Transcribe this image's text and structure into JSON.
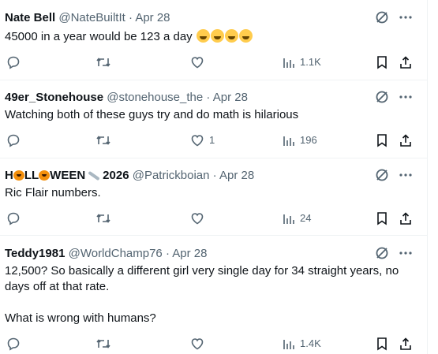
{
  "tweets": [
    {
      "name": "Nate Bell",
      "handle": "@NateBuiltIt",
      "dot": "·",
      "date": "Apr 28",
      "text": "45000 in a year would be 123 a day",
      "emoji": "rolling-on-floor-laughing-emoji x4",
      "reply_count": "",
      "retweet_count": "",
      "like_count": "",
      "views": "1.1K"
    },
    {
      "name": "49er_Stonehouse",
      "handle": "@stonehouse_the",
      "dot": "·",
      "date": "Apr 28",
      "text": "Watching both of these guys try and do math is hilarious",
      "reply_count": "",
      "retweet_count": "",
      "like_count": "1",
      "views": "196"
    },
    {
      "name_parts": [
        "H",
        "LL",
        "WEEN",
        "2026"
      ],
      "handle": "@Patrickboian",
      "dot": "·",
      "date": "Apr 28",
      "text": "Ric Flair numbers.",
      "reply_count": "",
      "retweet_count": "",
      "like_count": "",
      "views": "24"
    },
    {
      "name": "Teddy1981",
      "handle": "@WorldChamp76",
      "dot": "·",
      "date": "Apr 28",
      "text_line1": "12,500? So basically a different girl very single day for 34 straight years, no",
      "text_line2": "days off at that rate.",
      "text_line3": "What is wrong with humans?",
      "reply_count": "",
      "retweet_count": "",
      "like_count": "",
      "views": "1.4K"
    }
  ],
  "colors": {
    "text": "#0f1419",
    "muted": "#536471",
    "border": "#eff3f4"
  },
  "icons": [
    "reply-icon",
    "retweet-icon",
    "like-icon",
    "views-icon",
    "bookmark-icon",
    "share-icon",
    "grok-icon",
    "more-icon"
  ]
}
